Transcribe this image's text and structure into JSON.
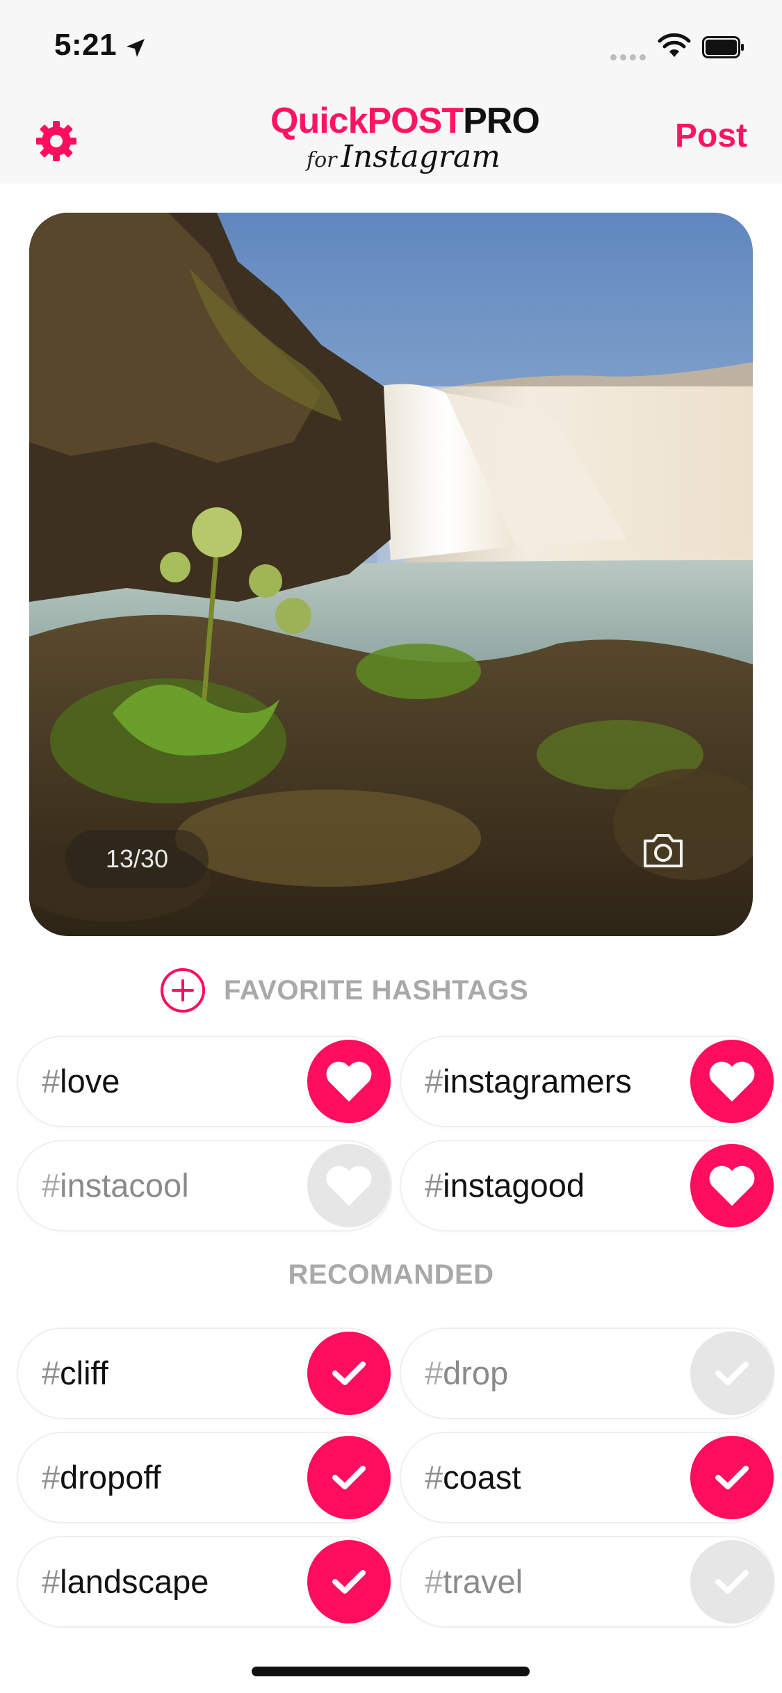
{
  "status_bar": {
    "time": "5:21"
  },
  "nav": {
    "logo_part1": "Quick",
    "logo_part2": "POST",
    "logo_part3": "PRO",
    "logo_for": "for",
    "logo_instagram": "Instagram",
    "post_label": "Post"
  },
  "photo": {
    "counter": "13/30"
  },
  "favorites": {
    "heading": "FAVORITE HASHTAGS",
    "items": [
      {
        "hash": "#",
        "tag": "love",
        "favorited": true
      },
      {
        "hash": "#",
        "tag": "instagramers",
        "favorited": true
      },
      {
        "hash": "#",
        "tag": "instacool",
        "favorited": false
      },
      {
        "hash": "#",
        "tag": "instagood",
        "favorited": true
      }
    ]
  },
  "recommended": {
    "heading": "RECOMANDED",
    "items": [
      {
        "hash": "#",
        "tag": "cliff",
        "selected": true
      },
      {
        "hash": "#",
        "tag": "drop",
        "selected": false
      },
      {
        "hash": "#",
        "tag": "dropoff",
        "selected": true
      },
      {
        "hash": "#",
        "tag": "coast",
        "selected": true
      },
      {
        "hash": "#",
        "tag": "landscape",
        "selected": true
      },
      {
        "hash": "#",
        "tag": "travel",
        "selected": false
      }
    ]
  },
  "colors": {
    "accent": "#ff0d5e",
    "inactive": "#e6e6e6",
    "muted_text": "#a9a9a9"
  }
}
